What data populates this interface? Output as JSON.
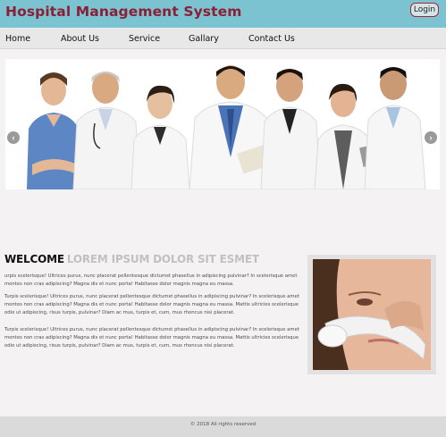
{
  "header": {
    "site_title": "Hospital Management System",
    "login_label": "Login"
  },
  "nav": {
    "items": [
      "Home",
      "About Us",
      "Service",
      "Gallary",
      "Contact Us"
    ]
  },
  "slider": {
    "prev_glyph": "‹",
    "next_glyph": "›"
  },
  "welcome": {
    "heading_dark": "WELCOME",
    "heading_light": "LOREM IPSUM DOLOR SIT ESMET"
  },
  "paragraphs": [
    "urpis scelerisque! Ultrices purus, nunc placerat pellentesque dictumst phasellus in adipiscing pulvinar? In scelerisque amet montes non cras adipiscing? Magna dis et nunc porta! Habitasse dolor magnis magna eu massa.",
    "Turpis scelerisque! Ultrices purus, nunc placerat pellentesque dictumst phasellus in adipiscing pulvinar? In scelerisque amet montes non cras adipiscing? Magna dis et nunc porta! Habitasse dolor magnis magna eu massa. Mattis ultricies scelerisque odio ut adipiscing, risus turpis, pulvinar? Diam ac mus, turpis et, cum, mus rhoncus nisi placerat.",
    "Turpis scelerisque! Ultrices purus, nunc placerat pellentesque dictumst phasellus in adipiscing pulvinar? In scelerisque amet montes non cras adipiscing? Magna dis et nunc porta! Habitasse dolor magnis magna eu massa. Mattis ultricies scelerisque odio ut adipiscing, risus turpis, pulvinar? Diam ac mus, turpis et, cum, mus rhoncus nisi placerat."
  ],
  "footer": {
    "copyright": "© 2018 All rights reserved"
  },
  "colors": {
    "header_bg": "#7cc3d1",
    "title_color": "#8a1f35",
    "nav_bg": "#e8e8e8",
    "footer_bg": "#dadada"
  }
}
